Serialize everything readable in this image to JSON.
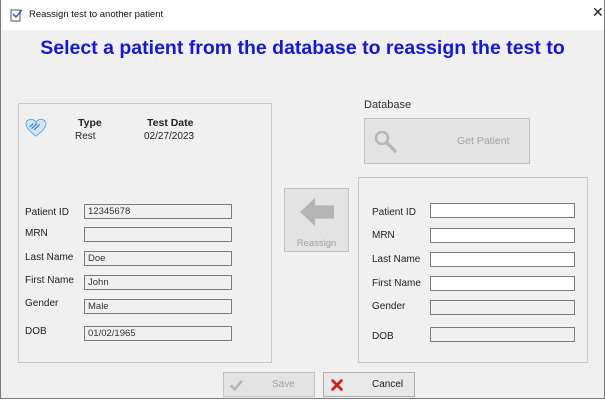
{
  "window": {
    "title": "Reassign test to another patient",
    "close_symbol": "✕"
  },
  "heading": "Select a patient from the database to reassign the test to",
  "current_test": {
    "icon": "heart-icon",
    "type_label": "Type",
    "type_value": "Rest",
    "date_label": "Test Date",
    "date_value": "02/27/2023"
  },
  "current_patient": {
    "fields": [
      {
        "label": "Patient ID",
        "value": "12345678"
      },
      {
        "label": "MRN",
        "value": ""
      },
      {
        "label": "Last Name",
        "value": "Doe"
      },
      {
        "label": "First Name",
        "value": "John"
      },
      {
        "label": "Gender",
        "value": "Male"
      },
      {
        "label": "DOB",
        "value": "01/02/1965"
      }
    ]
  },
  "reassign_button": {
    "label": "Reassign",
    "icon": "arrow-left-icon",
    "enabled": false
  },
  "database": {
    "title": "Database",
    "get_patient_button": {
      "label": "Get Patient",
      "icon": "search-icon",
      "enabled": false
    },
    "fields": [
      {
        "label": "Patient ID",
        "value": ""
      },
      {
        "label": "MRN",
        "value": ""
      },
      {
        "label": "Last Name",
        "value": ""
      },
      {
        "label": "First Name",
        "value": ""
      },
      {
        "label": "Gender",
        "value": ""
      },
      {
        "label": "DOB",
        "value": ""
      }
    ]
  },
  "footer": {
    "save_label": "Save",
    "save_icon": "checkmark-icon",
    "cancel_label": "Cancel",
    "cancel_icon": "x-icon"
  }
}
